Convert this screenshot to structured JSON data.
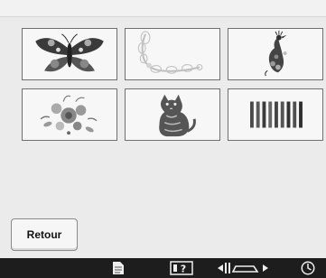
{
  "screen": {
    "designs": [
      {
        "name": "butterfly"
      },
      {
        "name": "floral-corner"
      },
      {
        "name": "peacock"
      },
      {
        "name": "flower-bouquet"
      },
      {
        "name": "cat"
      },
      {
        "name": "color-bars"
      }
    ],
    "back_button_label": "Retour"
  },
  "toolbar": {
    "icons": [
      "page-icon",
      "help-icon",
      "presser-foot-icon",
      "clock-icon"
    ]
  },
  "colors": {
    "panel_bg": "#ebebeb",
    "toolbar_bg": "#1d1d1d",
    "tile_border": "#6f6f6f"
  }
}
